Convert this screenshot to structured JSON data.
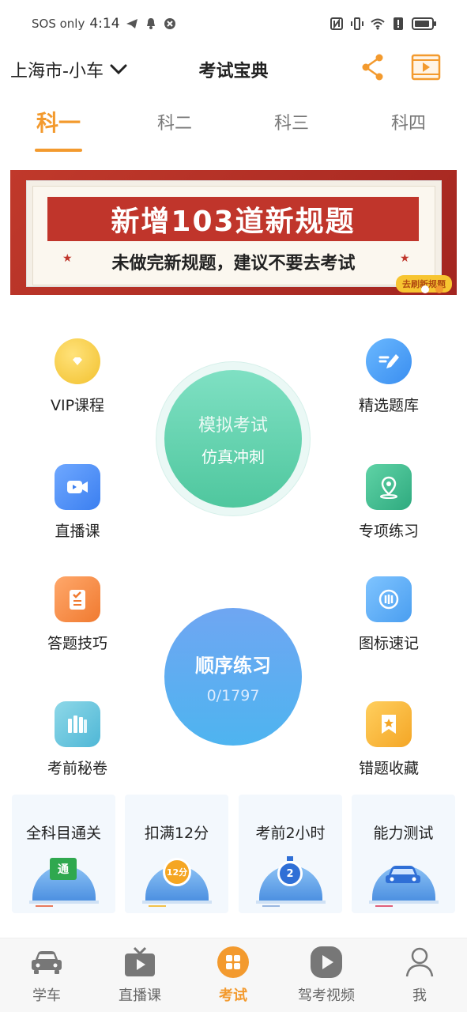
{
  "status_bar": {
    "carrier": "SOS only",
    "time": "4:14"
  },
  "header": {
    "city": "上海市-小车",
    "title": "考试宝典"
  },
  "tabs": [
    {
      "label": "科一",
      "active": true
    },
    {
      "label": "科二",
      "active": false
    },
    {
      "label": "科三",
      "active": false
    },
    {
      "label": "科四",
      "active": false
    }
  ],
  "banner": {
    "headline": "新增103道新规题",
    "subline": "未做完新规题，建议不要去考试",
    "cta": "去刷新规题"
  },
  "features": {
    "vip": "VIP课程",
    "selected_bank": "精选题库",
    "live": "直播课",
    "special": "专项练习",
    "tips": "答题技巧",
    "signs": "图标速记",
    "secret": "考前秘卷",
    "mistakes": "错题收藏"
  },
  "mock_exam": {
    "title": "模拟考试",
    "subtitle": "仿真冲刺"
  },
  "sequential": {
    "title": "顺序练习",
    "progress": "0/1797"
  },
  "cards": [
    {
      "label": "全科目通关",
      "badge": "通",
      "icon": "pass-badge-icon"
    },
    {
      "label": "扣满12分",
      "badge": "12分",
      "icon": "points-icon"
    },
    {
      "label": "考前2小时",
      "badge": "2",
      "icon": "stopwatch-icon"
    },
    {
      "label": "能力测试",
      "badge": "",
      "icon": "car-icon"
    }
  ],
  "bottom_nav": [
    {
      "label": "学车",
      "icon": "car-icon",
      "active": false
    },
    {
      "label": "直播课",
      "icon": "tv-play-icon",
      "active": false
    },
    {
      "label": "考试",
      "icon": "grid-icon",
      "active": true
    },
    {
      "label": "驾考视频",
      "icon": "play-circle-icon",
      "active": false
    },
    {
      "label": "我",
      "icon": "user-icon",
      "active": false
    }
  ],
  "colors": {
    "accent": "#f39a2e",
    "mock_green": "#5fd3a6",
    "seq_blue": "#5aa8f0",
    "banner_red": "#c0352b"
  }
}
